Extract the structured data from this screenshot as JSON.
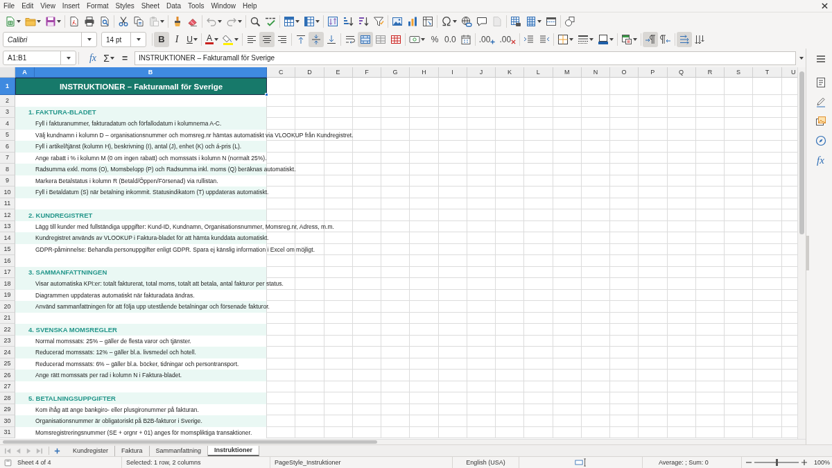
{
  "menu_bar": [
    "File",
    "Edit",
    "View",
    "Insert",
    "Format",
    "Styles",
    "Sheet",
    "Data",
    "Tools",
    "Window",
    "Help"
  ],
  "standard_toolbar": {
    "paste": {
      "disabled": true
    },
    "undo": {
      "disabled": true
    },
    "redo": {
      "disabled": true
    },
    "blank_page": {
      "disabled": true
    }
  },
  "format_toolbar": {
    "font_name": "Calibri",
    "font_size": "14 pt",
    "bold": {
      "label": "B",
      "selected": true
    },
    "italic": {
      "label": "I",
      "selected": false
    },
    "underline": {
      "label": "U",
      "selected": false
    },
    "font_color": {
      "label": "A"
    },
    "align_left": {
      "selected": false
    },
    "align_center": {
      "selected": true
    },
    "align_right": {
      "selected": false
    },
    "align_top": {
      "selected": false
    },
    "align_middle": {
      "selected": true
    },
    "align_bottom": {
      "selected": false
    },
    "wrap_text": {
      "selected": false
    },
    "merge_and_center": {
      "selected": true
    },
    "merge_cells": {
      "selected": false
    },
    "unmerge_cells": {
      "selected": false
    },
    "percent": {
      "label": "%"
    },
    "number_format": {
      "label": "0.0"
    },
    "add_decimal": {
      "label": ".00"
    },
    "delete_decimal": {
      "label": ".00"
    },
    "left_to_right": {
      "selected": true
    },
    "right_to_left": {
      "selected": false
    },
    "text_horizontal": {
      "selected": true
    },
    "text_vertical": {
      "selected": false
    }
  },
  "formula_bar": {
    "name_box": "A1:B1",
    "function_wizard": "fx",
    "sum": "Σ",
    "formula": "=",
    "content": "INSTRUKTIONER – Fakturamall för Sverige"
  },
  "sidebar": {
    "functions": "fx"
  },
  "columns": [
    {
      "label": "A",
      "selected": true
    },
    {
      "label": "B",
      "selected": true
    },
    {
      "label": "C",
      "selected": false
    },
    {
      "label": "D",
      "selected": false
    },
    {
      "label": "E",
      "selected": false
    },
    {
      "label": "F",
      "selected": false
    },
    {
      "label": "G",
      "selected": false
    },
    {
      "label": "H",
      "selected": false
    },
    {
      "label": "I",
      "selected": false
    },
    {
      "label": "J",
      "selected": false
    },
    {
      "label": "K",
      "selected": false
    },
    {
      "label": "L",
      "selected": false
    },
    {
      "label": "M",
      "selected": false
    },
    {
      "label": "N",
      "selected": false
    },
    {
      "label": "O",
      "selected": false
    },
    {
      "label": "P",
      "selected": false
    },
    {
      "label": "Q",
      "selected": false
    },
    {
      "label": "R",
      "selected": false
    },
    {
      "label": "S",
      "selected": false
    },
    {
      "label": "T",
      "selected": false
    },
    {
      "label": "U",
      "selected": false
    }
  ],
  "rows": [
    {
      "label": "1",
      "selected": true,
      "kind": "title",
      "text": "INSTRUKTIONER – Fakturamall för Sverige"
    },
    {
      "label": "2",
      "selected": false,
      "kind": "blank",
      "shaded": false
    },
    {
      "label": "3",
      "selected": false,
      "kind": "heading",
      "text": "1. FAKTURA-BLADET",
      "shaded": true
    },
    {
      "label": "4",
      "selected": false,
      "kind": "item",
      "text": "Fyll i fakturanummer, fakturadatum och förfallodatum i kolumnerna A-C.",
      "shaded": true
    },
    {
      "label": "5",
      "selected": false,
      "kind": "item",
      "text": "Välj kundnamn i kolumn D – organisationsnummer och momsreg.nr hämtas automatiskt via VLOOKUP från Kundregistret.",
      "shaded": false
    },
    {
      "label": "6",
      "selected": false,
      "kind": "item",
      "text": "Fyll i artikel/tjänst (kolumn H), beskrivning (I), antal (J), enhet (K) och á-pris (L).",
      "shaded": true
    },
    {
      "label": "7",
      "selected": false,
      "kind": "item",
      "text": "Ange rabatt i % i kolumn M (0 om ingen rabatt) och momssats i kolumn N (normalt 25%).",
      "shaded": false
    },
    {
      "label": "8",
      "selected": false,
      "kind": "item",
      "text": "Radsumma exkl. moms (O), Momsbelopp (P) och Radsumma inkl. moms (Q) beräknas automatiskt.",
      "shaded": true
    },
    {
      "label": "9",
      "selected": false,
      "kind": "item",
      "text": "Markera Betalstatus i kolumn R (Betald/Öppen/Försenad) via rullistan.",
      "shaded": false
    },
    {
      "label": "10",
      "selected": false,
      "kind": "item",
      "text": "Fyll i Betaldatum (S) när betalning inkommit. Statusindikatorn (T) uppdateras automatiskt.",
      "shaded": true
    },
    {
      "label": "11",
      "selected": false,
      "kind": "blank",
      "shaded": false
    },
    {
      "label": "12",
      "selected": false,
      "kind": "heading",
      "text": "2. KUNDREGISTRET",
      "shaded": true
    },
    {
      "label": "13",
      "selected": false,
      "kind": "item",
      "text": "Lägg till kunder med fullständiga uppgifter: Kund-ID, Kundnamn, Organisationsnummer, Momsreg.nr, Adress, m.m.",
      "shaded": false
    },
    {
      "label": "14",
      "selected": false,
      "kind": "item",
      "text": "Kundregistret används av VLOOKUP i Faktura-bladet för att hämta kunddata automatiskt.",
      "shaded": true
    },
    {
      "label": "15",
      "selected": false,
      "kind": "item",
      "text": "GDPR-påminnelse: Behandla personuppgifter enligt GDPR. Spara ej känslig information i Excel om möjligt.",
      "shaded": false
    },
    {
      "label": "16",
      "selected": false,
      "kind": "blank",
      "shaded": false
    },
    {
      "label": "17",
      "selected": false,
      "kind": "heading",
      "text": "3. SAMMANFATTNINGEN",
      "shaded": true
    },
    {
      "label": "18",
      "selected": false,
      "kind": "item",
      "text": "Visar automatiska KPI:er: totalt fakturerat, total moms, totalt att betala, antal fakturor per status.",
      "shaded": true
    },
    {
      "label": "19",
      "selected": false,
      "kind": "item",
      "text": "Diagrammen uppdateras automatiskt när fakturadata ändras.",
      "shaded": false
    },
    {
      "label": "20",
      "selected": false,
      "kind": "item",
      "text": "Använd sammanfattningen för att följa upp utestående betalningar och försenade fakturor.",
      "shaded": true
    },
    {
      "label": "21",
      "selected": false,
      "kind": "blank",
      "shaded": false
    },
    {
      "label": "22",
      "selected": false,
      "kind": "heading",
      "text": "4. SVENSKA MOMSREGLER",
      "shaded": true
    },
    {
      "label": "23",
      "selected": false,
      "kind": "item",
      "text": "Normal momssats: 25% – gäller de flesta varor och tjänster.",
      "shaded": false
    },
    {
      "label": "24",
      "selected": false,
      "kind": "item",
      "text": "Reducerad momssats: 12% – gäller bl.a. livsmedel och hotell.",
      "shaded": true
    },
    {
      "label": "25",
      "selected": false,
      "kind": "item",
      "text": "Reducerad momssats: 6% – gäller bl.a. böcker, tidningar och persontransport.",
      "shaded": false
    },
    {
      "label": "26",
      "selected": false,
      "kind": "item",
      "text": "Ange rätt momssats per rad i kolumn N i Faktura-bladet.",
      "shaded": true
    },
    {
      "label": "27",
      "selected": false,
      "kind": "blank",
      "shaded": false
    },
    {
      "label": "28",
      "selected": false,
      "kind": "heading",
      "text": "5. BETALNINGSUPPGIFTER",
      "shaded": true
    },
    {
      "label": "29",
      "selected": false,
      "kind": "item",
      "text": "Kom ihåg att ange bankgiro- eller plusgironummer på fakturan.",
      "shaded": false
    },
    {
      "label": "30",
      "selected": false,
      "kind": "item",
      "text": "Organisationsnummer är obligatoriskt på B2B-fakturor i Sverige.",
      "shaded": true
    },
    {
      "label": "31",
      "selected": false,
      "kind": "item",
      "text": "Momsregistreringsnummer (SE + orgnr + 01) anges för momspliktiga transaktioner.",
      "shaded": false
    }
  ],
  "sheet_tabs": [
    {
      "label": "Kundregister",
      "selected": false
    },
    {
      "label": "Faktura",
      "selected": false
    },
    {
      "label": "Sammanfattning",
      "selected": false
    },
    {
      "label": "Instruktioner",
      "selected": true
    }
  ],
  "status_bar": {
    "sheet": "Sheet 4 of 4",
    "selection": "Selected: 1 row, 2 columns",
    "page_style": "PageStyle_Instruktioner",
    "language": "English (USA)",
    "summary": "Average: ; Sum: 0",
    "zoom": {
      "label": "100%",
      "level": 0.5
    }
  }
}
